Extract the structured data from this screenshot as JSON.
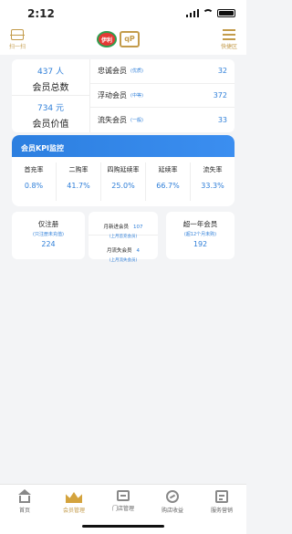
{
  "status_bar": {
    "time": "2:12"
  },
  "header": {
    "scan_label": "扫一扫",
    "logo_text": "伊利",
    "logo_sub": "qP",
    "shortcut_label": "快捷区"
  },
  "summary": {
    "total_members_value": "437 人",
    "total_members_label": "会员总数",
    "member_value": "734 元",
    "member_value_label": "会员价值",
    "rows": [
      {
        "name": "忠诚会员",
        "tag": "(优质)",
        "count": "32"
      },
      {
        "name": "浮动会员",
        "tag": "(中等)",
        "count": "372"
      },
      {
        "name": "流失会员",
        "tag": "(一般)",
        "count": "33"
      }
    ]
  },
  "kpi": {
    "title": "会员KPI监控",
    "items": [
      {
        "label": "首充率",
        "value": "0.8%"
      },
      {
        "label": "二购率",
        "value": "41.7%"
      },
      {
        "label": "四购延续率",
        "value": "25.0%"
      },
      {
        "label": "延续率",
        "value": "66.7%"
      },
      {
        "label": "流失率",
        "value": "33.3%"
      }
    ]
  },
  "stats": {
    "registered_title": "仅注册",
    "registered_sub": "(只注册未充值)",
    "registered_value": "224",
    "monthly_new_label": "月新进会员",
    "monthly_new_value": "107",
    "monthly_new_sub": "(上月首充会员)",
    "monthly_lost_label": "月流失会员",
    "monthly_lost_value": "4",
    "monthly_lost_sub": "(上月流失会员)",
    "year_title": "超一年会员",
    "year_sub": "(超12个月未购)",
    "year_value": "192"
  },
  "tabs": [
    {
      "label": "首页",
      "icon": "home-icon"
    },
    {
      "label": "会员管理",
      "icon": "crown-icon"
    },
    {
      "label": "门店管理",
      "icon": "store-icon"
    },
    {
      "label": "购店收益",
      "icon": "revenue-icon"
    },
    {
      "label": "服务营销",
      "icon": "service-icon"
    }
  ],
  "colors": {
    "accent": "#2f7fd9",
    "gold": "#c39b4a",
    "kpi_header": "#2c7fe0"
  }
}
